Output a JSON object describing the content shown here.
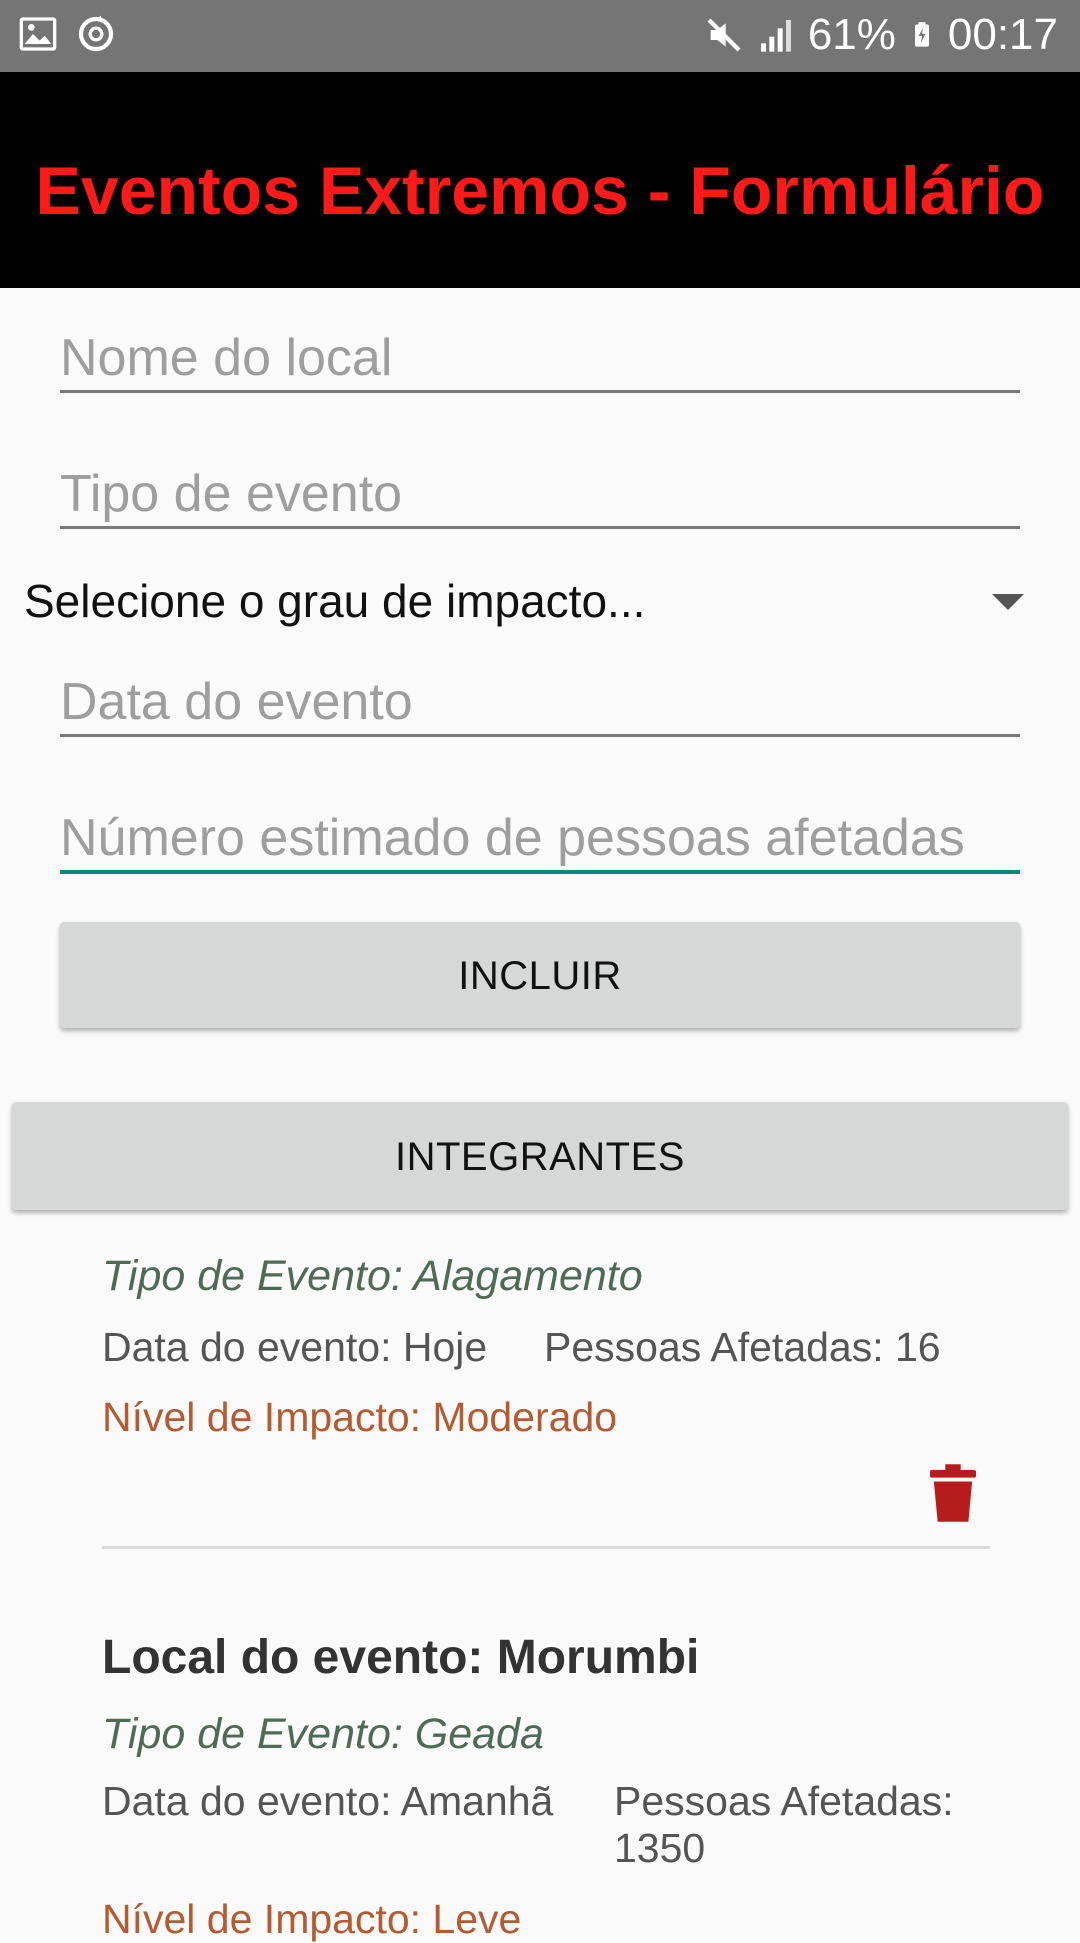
{
  "status_bar": {
    "battery": "61%",
    "time": "00:17",
    "icons": [
      "image-icon",
      "sync-icon",
      "mute-icon",
      "signal-icon",
      "battery-icon"
    ]
  },
  "app_bar": {
    "title": "Eventos Extremos - Formulário",
    "title_color": "#ff1a1a"
  },
  "form": {
    "local_placeholder": "Nome do local",
    "tipo_placeholder": "Tipo de evento",
    "impacto_selected": "Selecione o grau de impacto...",
    "data_placeholder": "Data do evento",
    "pessoas_placeholder": "Número estimado de pessoas afetadas",
    "incluir_label": "INCLUIR",
    "integrantes_label": "INTEGRANTES",
    "focus_color": "#00897b"
  },
  "events": [
    {
      "tipo": "Tipo de Evento: Alagamento",
      "data": "Data do evento: Hoje",
      "pessoas": "Pessoas Afetadas: 16",
      "nivel": "Nível de Impacto: Moderado"
    },
    {
      "local": "Local do evento: Morumbi",
      "tipo": "Tipo de Evento: Geada",
      "data": "Data do evento: Amanhã",
      "pessoas_label": "Pessoas Afetadas:",
      "pessoas_value": "1350",
      "nivel": "Nível de Impacto: Leve"
    }
  ]
}
